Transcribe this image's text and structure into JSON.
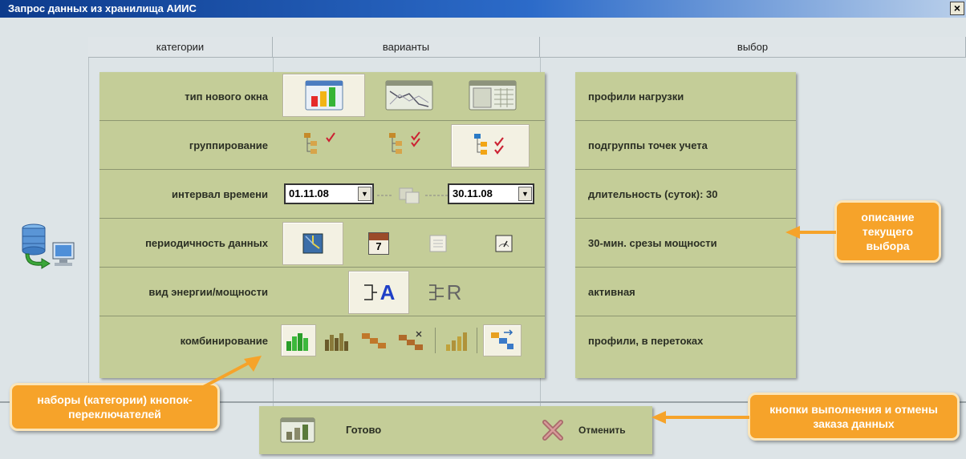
{
  "window": {
    "title": "Запрос данных из хранилища АИИС",
    "close_symbol": "×"
  },
  "headers": {
    "categories": "категории",
    "variants": "варианты",
    "choice": "выбор"
  },
  "rows": [
    {
      "label": "тип нового окна",
      "choice": "профили нагрузки"
    },
    {
      "label": "группирование",
      "choice": "подгруппы точек учета"
    },
    {
      "label": "интервал времени",
      "choice": "длительность (суток): 30"
    },
    {
      "label": "периодичность данных",
      "choice": "30-мин. срезы мощности"
    },
    {
      "label": "вид энергии/мощности",
      "choice": "активная"
    },
    {
      "label": "комбинирование",
      "choice": "профили, в перетоках"
    }
  ],
  "interval": {
    "from": "01.11.08",
    "to": "30.11.08",
    "dropdown_symbol": "▼"
  },
  "energy": {
    "active_letter": "A",
    "reactive_letter": "R"
  },
  "calendar_icon_day": "7",
  "actions": {
    "ok_label": "Готово",
    "cancel_label": "Отменить"
  },
  "callouts": {
    "description": "описание текущего выбора",
    "sets": "наборы (категории) кнопок-переключателей",
    "actions": "кнопки выполнения и отмены заказа данных"
  },
  "colors": {
    "panel": "#c4cd98",
    "accent": "#f6a32a",
    "title_bar": "#0d3b8c"
  }
}
